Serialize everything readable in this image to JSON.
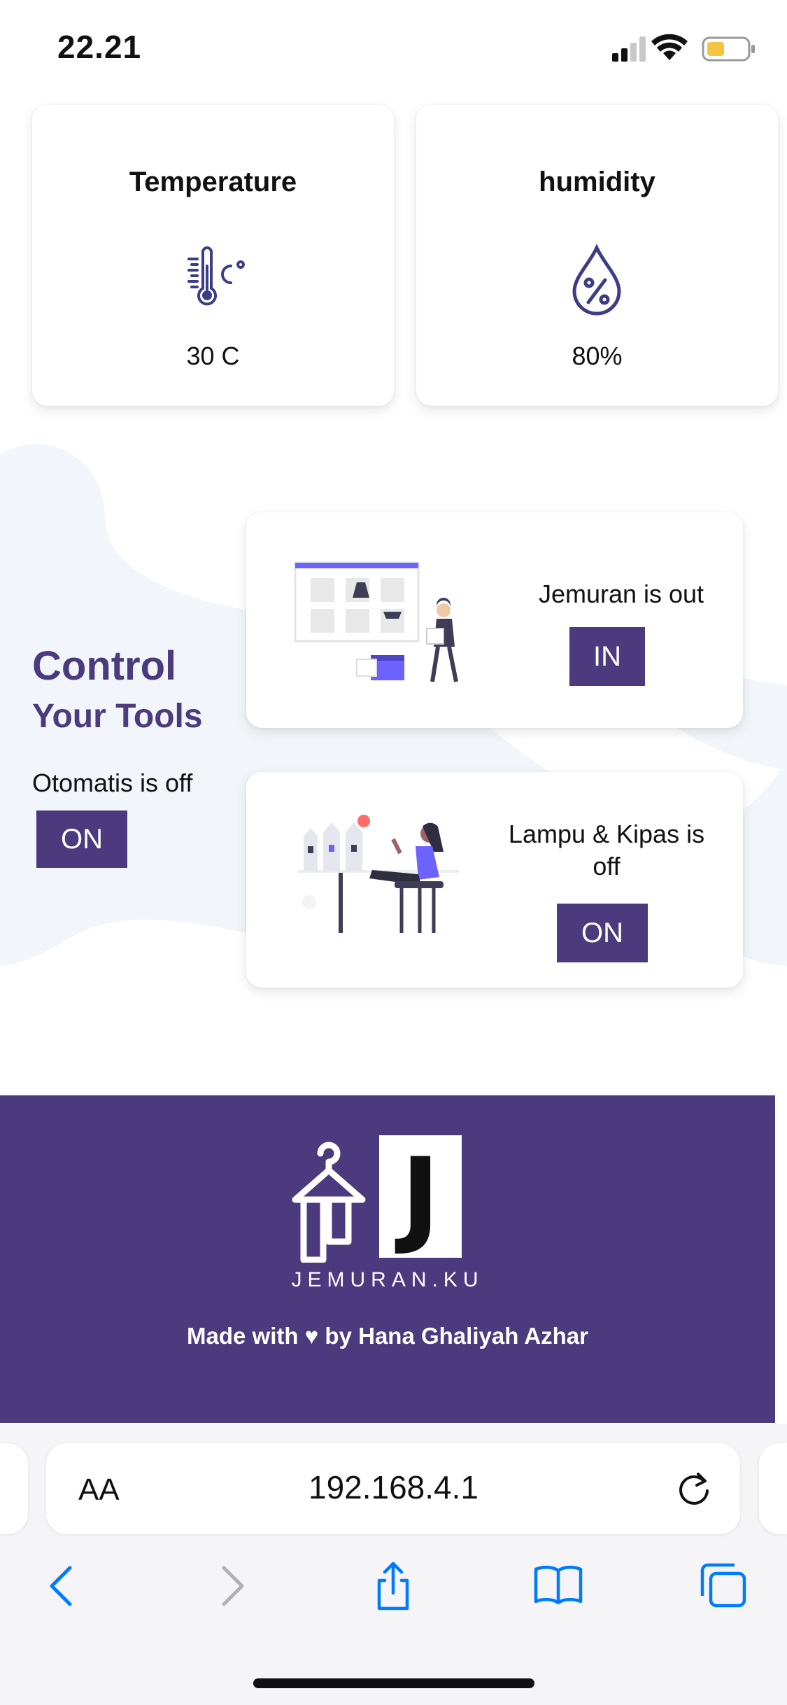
{
  "status_bar": {
    "time": "22.21"
  },
  "sensors": {
    "temperature": {
      "title": "Temperature",
      "value": "30 C"
    },
    "humidity": {
      "title": "humidity",
      "value": "80%"
    }
  },
  "control": {
    "title_line1": "Control",
    "title_line2": "Your Tools",
    "auto_status": "Otomatis is off",
    "auto_button": "ON"
  },
  "tools": {
    "jemuran": {
      "status": "Jemuran is out",
      "button": "IN"
    },
    "lampu": {
      "status_line1": "Lampu & Kipas is",
      "status_line2": "off",
      "button": "ON"
    }
  },
  "footer": {
    "brand_letter": "J",
    "brand_name": "JEMURAN.KU",
    "credit": "Made with ♥ by Hana Ghaliyah Azhar"
  },
  "browser": {
    "text_size_label": "AA",
    "url": "192.168.4.1"
  },
  "colors": {
    "accent": "#4b3a7d",
    "illustration_purple": "#6c63ff",
    "icon_blue": "#007aff"
  }
}
